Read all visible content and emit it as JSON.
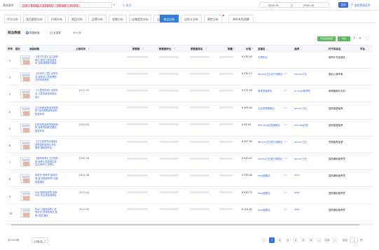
{
  "filter_bar": {
    "label": "筛选条件",
    "tags": [
      "全部",
      "母婴用品",
      "宝宝营养品",
      "奶粉/辅食",
      "营养补充"
    ],
    "plus_label": "+ 关注",
    "date_start": "2025-01",
    "date_sep": "至",
    "date_end": "2025-03",
    "query_button": "查询",
    "collapse_label": "收起筛选条件"
  },
  "tabs": [
    {
      "label": "平台分析"
    },
    {
      "label": "类目趋势分析"
    },
    {
      "label": "价格分布"
    },
    {
      "label": "类目分析"
    },
    {
      "label": "品牌分析"
    },
    {
      "label": "店铺分析"
    },
    {
      "label": "店铺类型分析"
    },
    {
      "label": "店铺分析"
    },
    {
      "label": "商品分析"
    },
    {
      "label": "自定义分析"
    },
    {
      "label": "属性分析"
    },
    {
      "label": "海外毛利测算"
    }
  ],
  "card": {
    "title": "商品数据",
    "radio_a": "数据维度：",
    "radio_b": "全品类",
    "count": "SKU/条",
    "export_label": "导出完整数据",
    "btn2_label": "导出",
    "help_icon": "help-icon",
    "settings_icon": "settings-icon"
  },
  "table": {
    "headers": [
      "序号",
      "图片",
      "商品标题",
      "上架时间",
      "销售额",
      "销售额环比",
      "销售额排名",
      "销量",
      "价格",
      "店铺名",
      "品牌",
      "叶子类目名",
      "平台"
    ],
    "rows": [
      {
        "idx": "1",
        "title": "【诺贝尔奖】益生菌营养片 婴幼儿肠道营养素 温和调理肠胃健康",
        "date": "",
        "price": "¥ 135.00",
        "shop": "大漂亮店",
        "ext": "",
        "brand": "",
        "leaf": "营养补充保健品",
        "has_ext": false
      },
      {
        "idx": "2",
        "title": "【中老年儿童】营养补充 营养液儿童营养配方奶粉营养素",
        "date": "",
        "price": "¥ 130.17",
        "shop": "Neuvio卫生官方旗舰店",
        "ext": "[↗",
        "brand": "neuvio卫生",
        "leaf": "婴幼儿营养素",
        "has_ext": true
      },
      {
        "idx": "3",
        "title": "【儿童钙铁锌】营养补充 儿童多维营养素咀嚼片",
        "date": "2017-02",
        "price": "¥ 171.09",
        "shop": "爱漂亮旗舰店",
        "ext": "[↗",
        "brand": "m-plus/爱漂亮",
        "leaf": "营养膳食补充剂",
        "has_ext": true
      },
      {
        "idx": "4",
        "title": "卫仕营养品鱼油宠物营养 DHA宠物营养品狗狗营养膏",
        "date": "",
        "price": "¥ 169.00",
        "shop": "卫仕宠物旗舰店",
        "ext": "[↗",
        "brand": "neuvio卫仕",
        "leaf": "猫狗保健营养",
        "has_ext": true
      },
      {
        "idx": "5",
        "title": "红狗宠物营养膏猫咪狗狗 营养膏增肥发腮幼猫营养品",
        "date": "2020-02",
        "price": "¥ 99.00",
        "shop": "Red-Dog红狗旗舰店",
        "ext": "[↗",
        "brand": "red-dog红狗",
        "leaf": "猫狗保健营养",
        "has_ext": true
      },
      {
        "idx": "6",
        "title": "【卫仕营养膏大罐装】 宠物猫狗营养补充剂 猫咪 通用营养品",
        "date": "",
        "price": "¥ 107.90",
        "shop": "Neuvio卫仕官方旗舰店",
        "ext": "[↗",
        "brand": "neuvio卫仕",
        "leaf": "宠物营养保健",
        "has_ext": true
      },
      {
        "idx": "7",
        "title": "【猫咪营养】卫仕猫多维 营养片猫用维生素复合营养片 宠物片",
        "date": "2024-06",
        "price": "¥ 223.47",
        "shop": "neuvio卫仕官方旗舰店",
        "ext": "[↗",
        "brand": "neuvio卫仕",
        "leaf": "猫狗通用营养膏",
        "has_ext": true
      },
      {
        "idx": "8",
        "title": "麦德氏 营养膏 猫咪营养 猫 宠物营养膏 幼猫 成猫通用",
        "date": "2021-08",
        "price": "¥ 255.00",
        "shop": "mag旗舰店",
        "ext": "[↗",
        "brand": "mag",
        "leaf": "猫狗通用营养膏",
        "has_ext": true
      },
      {
        "idx": "9",
        "title": "MAG猫咪营养膏 营养补充 化毛膏猫营养品",
        "date": "2022-04",
        "price": "¥ 313.72",
        "shop": "mag旗舰店",
        "ext": "[↗",
        "brand": "mag",
        "leaf": "猫狗通用营养膏",
        "has_ext": true
      },
      {
        "idx": "10",
        "title": "MAG【猫咪营养】营养补充 宠物营养品 猫咪 成猫 通用",
        "date": "2019-08",
        "price": "¥ 102.02",
        "shop": "mag旗舰店",
        "ext": "[↗",
        "brand": "mag",
        "leaf": "猫狗通用营养膏",
        "has_ext": true
      }
    ]
  },
  "pagination": {
    "total": "共1500条",
    "page_size": "10条/页",
    "prev": "‹",
    "pages": [
      "1",
      "2",
      "3",
      "4",
      "5",
      "6",
      "...",
      "150"
    ],
    "next": "›",
    "goto_label": "前往",
    "goto_value": "1",
    "page_suffix": "页"
  }
}
